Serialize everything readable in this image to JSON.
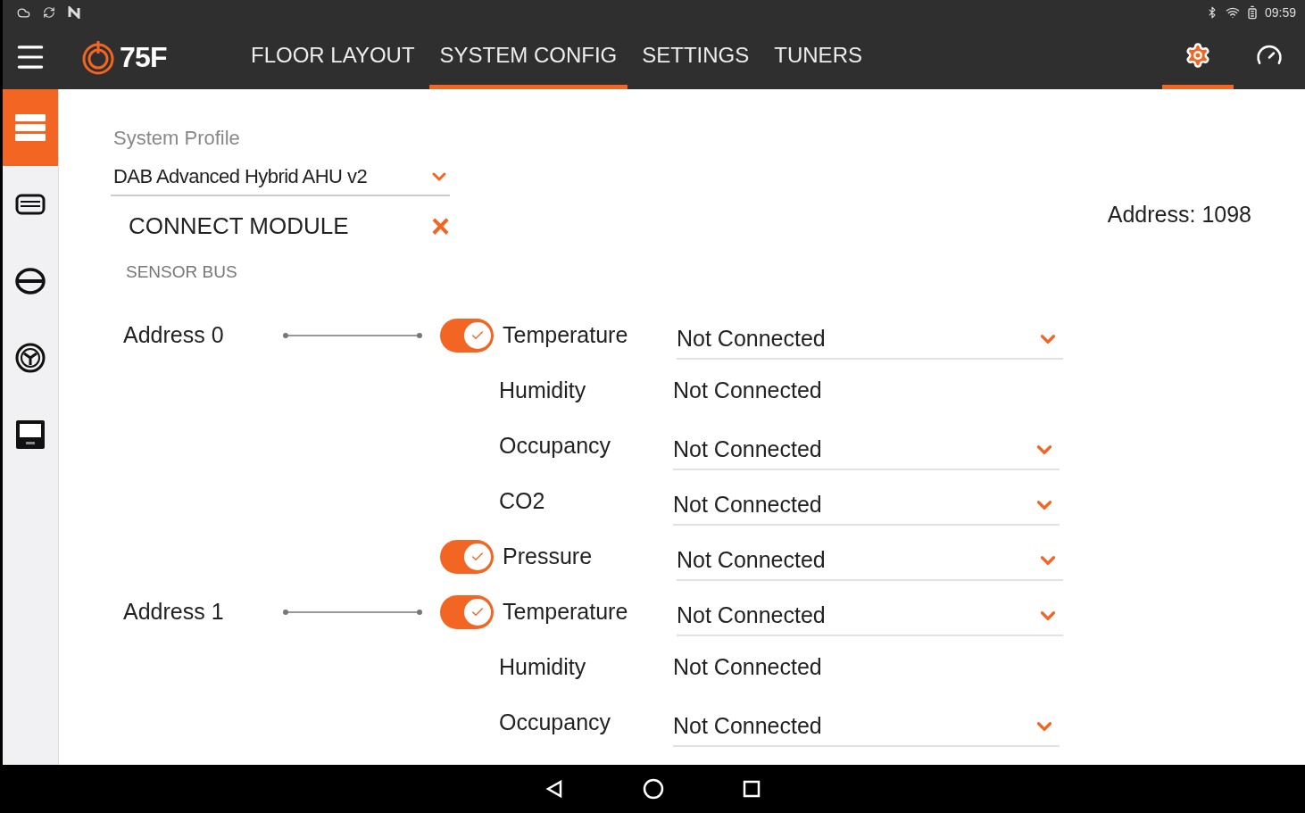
{
  "status_bar": {
    "time": "09:59"
  },
  "app_bar": {
    "logo": "75F",
    "tabs": [
      {
        "label": "FLOOR LAYOUT",
        "selected": false
      },
      {
        "label": "SYSTEM CONFIG",
        "selected": true
      },
      {
        "label": "SETTINGS",
        "selected": false
      },
      {
        "label": "TUNERS",
        "selected": false
      }
    ],
    "actions": [
      {
        "kind": "settings",
        "selected": true
      },
      {
        "kind": "dashboard",
        "selected": false
      }
    ]
  },
  "sidebar": {
    "items": [
      {
        "kind": "system",
        "selected": true
      },
      {
        "kind": "module",
        "selected": false
      },
      {
        "kind": "bus",
        "selected": false
      },
      {
        "kind": "fan",
        "selected": false
      },
      {
        "kind": "thermostat",
        "selected": false
      }
    ]
  },
  "system_profile": {
    "label": "System Profile",
    "value": "DAB Advanced Hybrid AHU v2"
  },
  "connect_module": {
    "title": "CONNECT MODULE",
    "close": "×"
  },
  "address": "Address: 1098",
  "sensor_bus": {
    "title": "SENSOR BUS",
    "groups": [
      {
        "address": "Address 0",
        "sensors": [
          {
            "label": "Temperature",
            "kind": "toggle",
            "on": true,
            "value": "Not Connected",
            "dropdown": true
          },
          {
            "label": "Humidity",
            "kind": "plain",
            "value": "Not Connected",
            "dropdown": false
          },
          {
            "label": "Occupancy",
            "kind": "plain",
            "value": "Not Connected",
            "dropdown": true
          },
          {
            "label": "CO2",
            "kind": "plain",
            "value": "Not Connected",
            "dropdown": true
          },
          {
            "label": "Pressure",
            "kind": "toggle",
            "on": true,
            "value": "Not Connected",
            "dropdown": true
          }
        ]
      },
      {
        "address": "Address 1",
        "sensors": [
          {
            "label": "Temperature",
            "kind": "toggle",
            "on": true,
            "value": "Not Connected",
            "dropdown": true
          },
          {
            "label": "Humidity",
            "kind": "plain",
            "value": "Not Connected",
            "dropdown": false
          },
          {
            "label": "Occupancy",
            "kind": "plain",
            "value": "Not Connected",
            "dropdown": true
          }
        ]
      }
    ]
  }
}
